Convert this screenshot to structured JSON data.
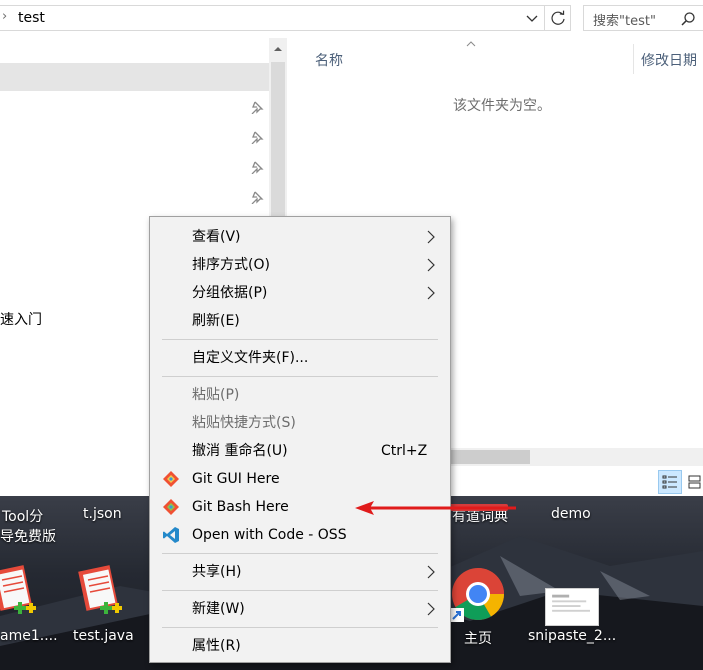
{
  "address": {
    "path": "test"
  },
  "search": {
    "placeholder": "搜索\"test\""
  },
  "nav": {
    "partial_item": "速入门"
  },
  "columns": {
    "name": "名称",
    "date_modified": "修改日期"
  },
  "empty_message": "该文件夹为空。",
  "desktop": {
    "items": [
      {
        "label_line1": "Tool分",
        "label_line2": "导免费版"
      },
      {
        "label": "t.json"
      },
      {
        "label": "有道词典"
      },
      {
        "label": "demo"
      },
      {
        "label": "ame1...."
      },
      {
        "label": "test.java"
      },
      {
        "label": "主页"
      },
      {
        "label": "snipaste_2..."
      }
    ]
  },
  "context_menu": {
    "items": [
      {
        "label": "查看(V)",
        "submenu": true
      },
      {
        "label": "排序方式(O)",
        "submenu": true
      },
      {
        "label": "分组依据(P)",
        "submenu": true
      },
      {
        "label": "刷新(E)"
      },
      {
        "label": "自定义文件夹(F)..."
      },
      {
        "label": "粘贴(P)",
        "disabled": true
      },
      {
        "label": "粘贴快捷方式(S)",
        "disabled": true
      },
      {
        "label": "撤消 重命名(U)",
        "shortcut": "Ctrl+Z"
      },
      {
        "label": "Git GUI Here",
        "icon": "git-gui-icon"
      },
      {
        "label": "Git Bash Here",
        "icon": "git-bash-icon"
      },
      {
        "label": "Open with Code - OSS",
        "icon": "vscode-icon"
      },
      {
        "label": "共享(H)",
        "submenu": true
      },
      {
        "label": "新建(W)",
        "submenu": true
      },
      {
        "label": "属性(R)"
      }
    ]
  },
  "colors": {
    "menu_bg": "#f2f2f2",
    "disabled_text": "#6d6d6d",
    "arrow": "#e01b1b",
    "selection": "#cce8ff"
  }
}
